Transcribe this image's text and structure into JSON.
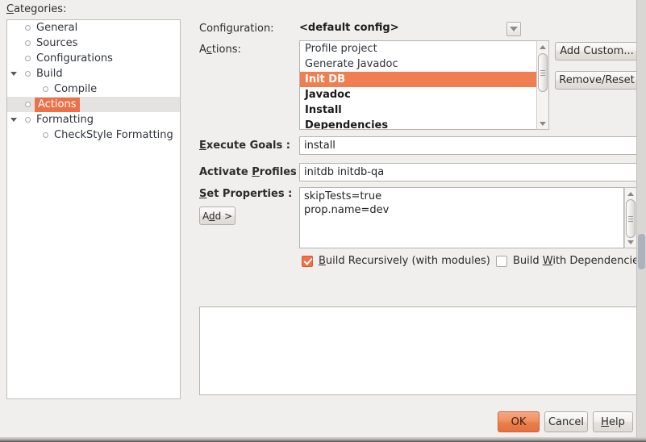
{
  "categories": {
    "label": "Categories:",
    "label_mnemonic": "C",
    "items": [
      {
        "text": "General",
        "depth": 1,
        "twisty": false,
        "selected": false
      },
      {
        "text": "Sources",
        "depth": 1,
        "twisty": false,
        "selected": false
      },
      {
        "text": "Configurations",
        "depth": 1,
        "twisty": false,
        "selected": false
      },
      {
        "text": "Build",
        "depth": 1,
        "twisty": true,
        "selected": false
      },
      {
        "text": "Compile",
        "depth": 2,
        "twisty": false,
        "selected": false
      },
      {
        "text": "Actions",
        "depth": 1,
        "twisty": false,
        "selected": true
      },
      {
        "text": "Formatting",
        "depth": 1,
        "twisty": true,
        "selected": false
      },
      {
        "text": "CheckStyle Formatting",
        "depth": 2,
        "twisty": false,
        "selected": false
      }
    ]
  },
  "configuration": {
    "label": "Configuration:",
    "value": "<default config>"
  },
  "actions": {
    "label": "Actions:",
    "items": [
      {
        "text": "Profile project",
        "bold": false,
        "selected": false
      },
      {
        "text": "Generate Javadoc",
        "bold": false,
        "selected": false
      },
      {
        "text": "Init DB",
        "bold": true,
        "selected": true
      },
      {
        "text": "Javadoc",
        "bold": true,
        "selected": false
      },
      {
        "text": "Install",
        "bold": true,
        "selected": false
      },
      {
        "text": "Dependencies",
        "bold": true,
        "selected": false
      }
    ],
    "add_custom_label": "Add Custom...",
    "remove_reset_label": "Remove/Reset"
  },
  "execute_goals": {
    "label": "Execute Goals :",
    "value": "install"
  },
  "activate_profiles": {
    "label": "Activate Profiles :",
    "value": "initdb initdb-qa"
  },
  "set_properties": {
    "label": "Set Properties :",
    "add_label": "Add >",
    "value": "skipTests=true\nprop.name=dev"
  },
  "options": {
    "build_recursively": {
      "label": "Build Recursively (with modules)",
      "checked": true
    },
    "build_with_dependencies": {
      "label": "Build With Dependencie",
      "checked": false
    }
  },
  "footer": {
    "ok_label": "OK",
    "cancel_label": "Cancel",
    "help_label": "Help"
  },
  "colors": {
    "selection_orange": "#ef7f50",
    "tree_tag_orange": "#ec7048",
    "checkbox_orange": "#ef7246",
    "window_bg": "#f0efed",
    "field_bg": "#ffffff"
  }
}
